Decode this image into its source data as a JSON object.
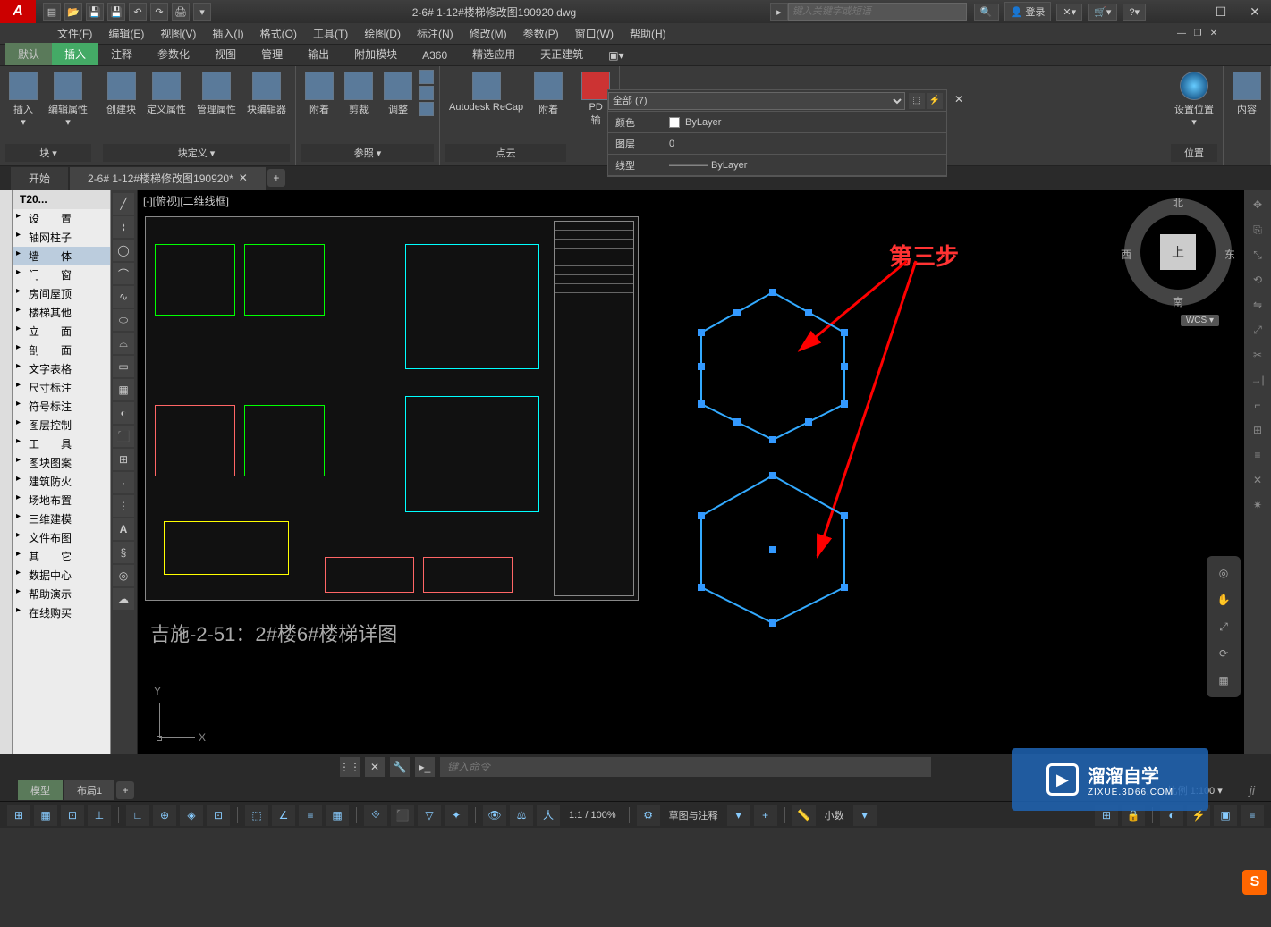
{
  "title": "2-6# 1-12#楼梯修改图190920.dwg",
  "search_placeholder": "键入关键字或短语",
  "login_label": "登录",
  "qat": [
    "▤",
    "📂",
    "💾",
    "💾",
    "↶",
    "↷",
    "🖨"
  ],
  "win": {
    "min": "—",
    "max": "☐",
    "close": "✕"
  },
  "menus": [
    "文件(F)",
    "编辑(E)",
    "视图(V)",
    "插入(I)",
    "格式(O)",
    "工具(T)",
    "绘图(D)",
    "标注(N)",
    "修改(M)",
    "参数(P)",
    "窗口(W)",
    "帮助(H)"
  ],
  "ribbon_tabs": [
    "默认",
    "插入",
    "注释",
    "参数化",
    "视图",
    "管理",
    "输出",
    "附加模块",
    "A360",
    "精选应用",
    "天正建筑"
  ],
  "ribbon_active": 1,
  "ribbon_panels": [
    {
      "title": "块 ▾",
      "buttons": [
        "插入",
        "编辑属性"
      ]
    },
    {
      "title": "块定义 ▾",
      "buttons": [
        "创建块",
        "定义属性",
        "管理属性",
        "块编辑器"
      ]
    },
    {
      "title": "参照 ▾",
      "buttons": [
        "附着",
        "剪裁",
        "调整"
      ]
    },
    {
      "title": "点云",
      "buttons": [
        "Autodesk ReCap",
        "附着"
      ]
    },
    {
      "title": "",
      "buttons": [
        "PD",
        "输"
      ]
    },
    {
      "title": "位置",
      "buttons": [
        "设置位置"
      ]
    },
    {
      "title": "",
      "buttons": [
        "内容"
      ]
    }
  ],
  "props": {
    "selector": "全部 (7)",
    "rows": [
      {
        "label": "颜色",
        "value": "ByLayer",
        "swatch": true
      },
      {
        "label": "图层",
        "value": "0"
      },
      {
        "label": "线型",
        "value": "———— ByLayer"
      }
    ]
  },
  "doc_tabs": [
    "开始",
    "2-6# 1-12#楼梯修改图190920*"
  ],
  "doc_active": 1,
  "sidebar_title": "T20...",
  "sidebar_items": [
    "设　　置",
    "轴网柱子",
    "墙　　体",
    "门　　窗",
    "房间屋顶",
    "楼梯其他",
    "立　　面",
    "剖　　面",
    "文字表格",
    "尺寸标注",
    "符号标注",
    "图层控制",
    "工　　具",
    "图块图案",
    "建筑防火",
    "场地布置",
    "三维建模",
    "文件布图",
    "其　　它",
    "数据中心",
    "帮助演示",
    "在线购买"
  ],
  "sidebar_selected": 2,
  "viewport_label": "[-][俯视][二维线框]",
  "drawing_caption": "吉施-2-51：2#楼6#楼梯详图",
  "annotation": "第三步",
  "viewcube": {
    "north": "北",
    "south": "南",
    "east": "东",
    "west": "西",
    "top": "上"
  },
  "wcs": "WCS ▾",
  "layout_tabs": [
    "模型",
    "布局1"
  ],
  "cmd_placeholder": "键入命令",
  "status": {
    "zoom": "1:1 / 100%",
    "anno": "草图与注释",
    "decimal": "小数",
    "scale": "比例 1:100 ▾",
    "ji": "ji"
  },
  "watermark": {
    "main": "溜溜自学",
    "sub": "ZIXUE.3D66.COM"
  },
  "ucs": {
    "x": "X",
    "y": "Y"
  }
}
